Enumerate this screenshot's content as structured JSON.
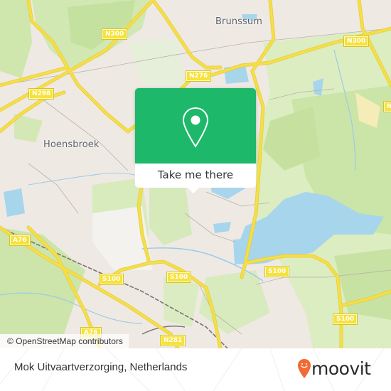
{
  "map": {
    "places": [
      {
        "id": "brunssum",
        "name": "Brunssum"
      },
      {
        "id": "hoensbroek",
        "name": "Hoensbroek"
      }
    ],
    "road_shields": [
      {
        "id": "n300-west",
        "label": "N300"
      },
      {
        "id": "n300-east",
        "label": "N300"
      },
      {
        "id": "n298",
        "label": "N298"
      },
      {
        "id": "n276",
        "label": "N276"
      },
      {
        "id": "a76-west",
        "label": "A76"
      },
      {
        "id": "a76-south",
        "label": "A76"
      },
      {
        "id": "s100-west",
        "label": "S100"
      },
      {
        "id": "s100-mid",
        "label": "S100"
      },
      {
        "id": "s100-east",
        "label": "S100"
      },
      {
        "id": "s100-southeast",
        "label": "S100"
      },
      {
        "id": "n281",
        "label": "N281"
      },
      {
        "id": "n-edge",
        "label": "N"
      }
    ],
    "attribution": "© OpenStreetMap contributors",
    "colors": {
      "land": "#efe9e4",
      "forest": "#c9e4a6",
      "park": "#dcedc1",
      "water": "#a7d5ec",
      "road": "#f6de4a",
      "shield": "#f6e23a"
    }
  },
  "popup": {
    "icon": "map-pin-icon",
    "button_label": "Take me there",
    "color": "#1db86a"
  },
  "footer": {
    "location_name": "Mok Uitvaartverzorging, Netherlands",
    "brand": "moovit",
    "brand_icon": "moovit-smiley-pin-icon",
    "brand_color": "#f26a35"
  }
}
